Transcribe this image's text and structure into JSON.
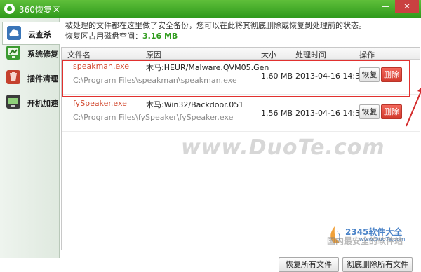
{
  "window": {
    "title": "360恢复区",
    "minimize_glyph": "—",
    "close_glyph": "✕"
  },
  "sidebar": {
    "items": [
      {
        "label": "云查杀",
        "icon": "cloud-scan-icon",
        "active": true
      },
      {
        "label": "系统修复",
        "icon": "system-repair-icon",
        "active": false
      },
      {
        "label": "插件清理",
        "icon": "plugin-clean-icon",
        "active": false
      },
      {
        "label": "开机加速",
        "icon": "boot-speed-icon",
        "active": false
      }
    ]
  },
  "main": {
    "note": "被处理的文件都在这里做了安全备份，您可以在此将其彻底删除或恢复到处理前的状态。",
    "space_label": "恢复区占用磁盘空间：",
    "space_value": "3.16 MB"
  },
  "table": {
    "headers": [
      "文件名",
      "原因",
      "大小",
      "处理时间",
      "操作"
    ],
    "rows": [
      {
        "filename": "speakman.exe",
        "path": "C:\\Program Files\\speakman\\speakman.exe",
        "reason": "木马:HEUR/Malware.QVM05.Gen",
        "size": "1.60 MB",
        "time": "2013-04-16 14:31:11",
        "restore_label": "恢复",
        "delete_label": "删除"
      },
      {
        "filename": "fySpeaker.exe",
        "path": "C:\\Program Files\\fySpeaker\\fySpeaker.exe",
        "reason": "木马:Win32/Backdoor.051",
        "size": "1.56 MB",
        "time": "2013-04-16 14:31:10",
        "restore_label": "恢复",
        "delete_label": "删除"
      }
    ]
  },
  "footer": {
    "restore_all": "恢复所有文件",
    "delete_all": "彻底删除所有文件"
  },
  "watermarks": {
    "site": "www.DuoTe.com",
    "brand": "2345软件大全",
    "brand_url": "www.DuoTe.com",
    "slogan": "国内最安全的软件站"
  },
  "colors": {
    "titlebar": "#3aa827",
    "filename": "#d24a30",
    "highlight": "#e1312f",
    "space_value": "#2e9b1c",
    "delete_button": "#d23a2d"
  }
}
